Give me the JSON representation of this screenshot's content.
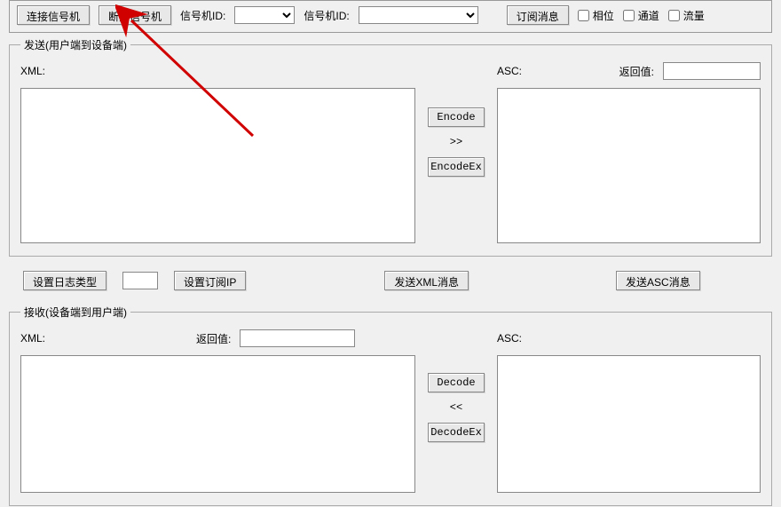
{
  "top": {
    "connect_btn": "连接信号机",
    "disconnect_btn": "断开信号机",
    "signal_id_label1": "信号机ID:",
    "signal_id_value1": "",
    "signal_id_label2": "信号机ID:",
    "signal_id_value2": "",
    "subscribe_btn": "订阅消息",
    "checkbox_phase": "相位",
    "checkbox_channel": "通道",
    "checkbox_flow": "流量"
  },
  "send": {
    "legend": "发送(用户端到设备端)",
    "xml_label": "XML:",
    "xml_value": "",
    "asc_label": "ASC:",
    "asc_value": "",
    "ret_label": "返回值:",
    "ret_value": "",
    "encode_btn": "Encode",
    "arrow": ">>",
    "encodeex_btn": "EncodeEx"
  },
  "mid": {
    "set_log_type_btn": "设置日志类型",
    "log_type_value": "",
    "set_sub_ip_btn": "设置订阅IP",
    "send_xml_btn": "发送XML消息",
    "send_asc_btn": "发送ASC消息"
  },
  "recv": {
    "legend": "接收(设备端到用户端)",
    "xml_label": "XML:",
    "xml_value": "",
    "ret_label": "返回值:",
    "ret_value": "",
    "asc_label": "ASC:",
    "asc_value": "",
    "decode_btn": "Decode",
    "arrow": "<<",
    "decodeex_btn": "DecodeEx"
  }
}
